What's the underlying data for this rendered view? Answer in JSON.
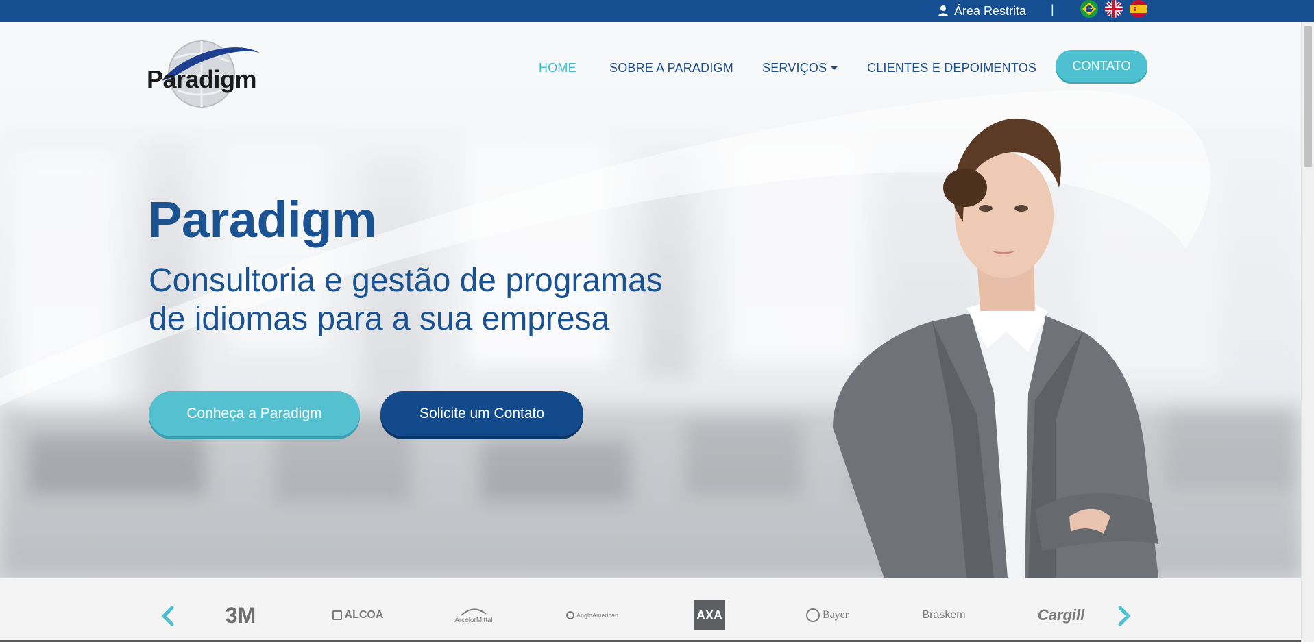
{
  "topbar": {
    "area_restrita": "Área Restrita",
    "separator": "|",
    "languages": [
      "Português (Brasil)",
      "English",
      "Español"
    ]
  },
  "brand": {
    "logo_text": "Paradigm"
  },
  "nav": {
    "items": [
      "HOME",
      "SOBRE A PARADIGM",
      "SERVIÇOS",
      "CLIENTES E DEPOIMENTOS"
    ],
    "active": "HOME",
    "cta": "CONTATO"
  },
  "hero": {
    "title": "Paradigm",
    "subtitle_line1": "Consultoria e gestão de programas",
    "subtitle_line2": "de idiomas para a sua empresa",
    "btn_primary": "Conheça a Paradigm",
    "btn_secondary": "Solicite um Contato"
  },
  "clients": {
    "logos": [
      "3M",
      "ALCOA",
      "ArcelorMittal",
      "AngloAmerican",
      "AXA",
      "Bayer",
      "Braskem",
      "Cargill"
    ]
  },
  "colors": {
    "brand_blue": "#154f91",
    "accent_teal": "#4ec1d1",
    "dark_blue": "#124a8c"
  }
}
